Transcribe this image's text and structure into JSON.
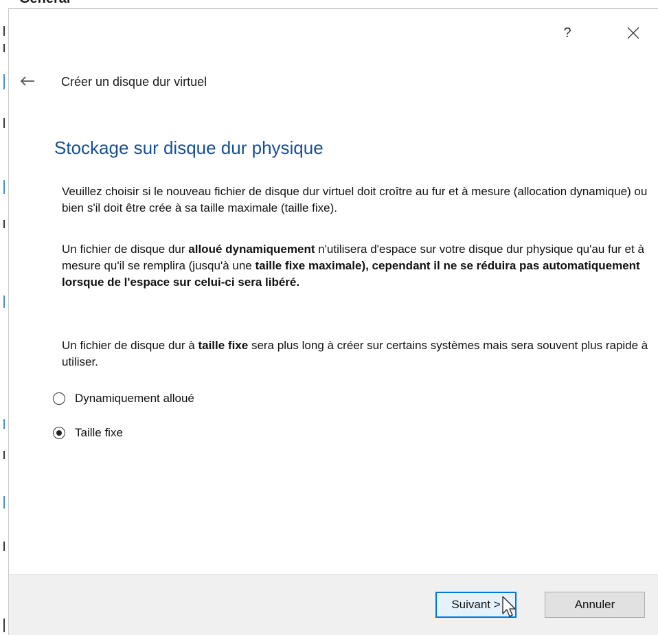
{
  "background": {
    "partial_title": "Général"
  },
  "titlebar": {
    "help_label": "?",
    "close_label": "×"
  },
  "wizard": {
    "title": "Créer un disque dur virtuel",
    "heading": "Stockage sur disque dur physique",
    "paragraph1": "Veuillez choisir si le nouveau fichier de disque dur virtuel doit croître au fur et à mesure (allocation dynamique) ou bien s'il doit être crée à sa taille maximale (taille fixe).",
    "paragraph2": {
      "t1": "Un fichier de disque dur ",
      "b1": "alloué dynamiquement",
      "t2": " n'utilisera d'espace sur votre disque dur physique qu'au fur et à mesure qu'il se remplira (jusqu'à une ",
      "b2": "taille fixe maximale), cependant il ne se réduira pas automatiquement lorsque de l'espace sur celui-ci sera libéré."
    },
    "paragraph3": {
      "t1": "Un fichier de disque dur à ",
      "b1": "taille fixe",
      "t2": " sera plus long à créer sur certains systèmes mais sera souvent plus rapide à utiliser."
    },
    "options": [
      {
        "label": "Dynamiquement alloué",
        "selected": false
      },
      {
        "label": "Taille fixe",
        "selected": true
      }
    ]
  },
  "footer": {
    "next_label": "Suivant >",
    "cancel_label": "Annuler"
  },
  "colors": {
    "heading": "#1a4f8f",
    "default_button_border": "#0078d7",
    "footer_bg": "#f0f0f0"
  }
}
